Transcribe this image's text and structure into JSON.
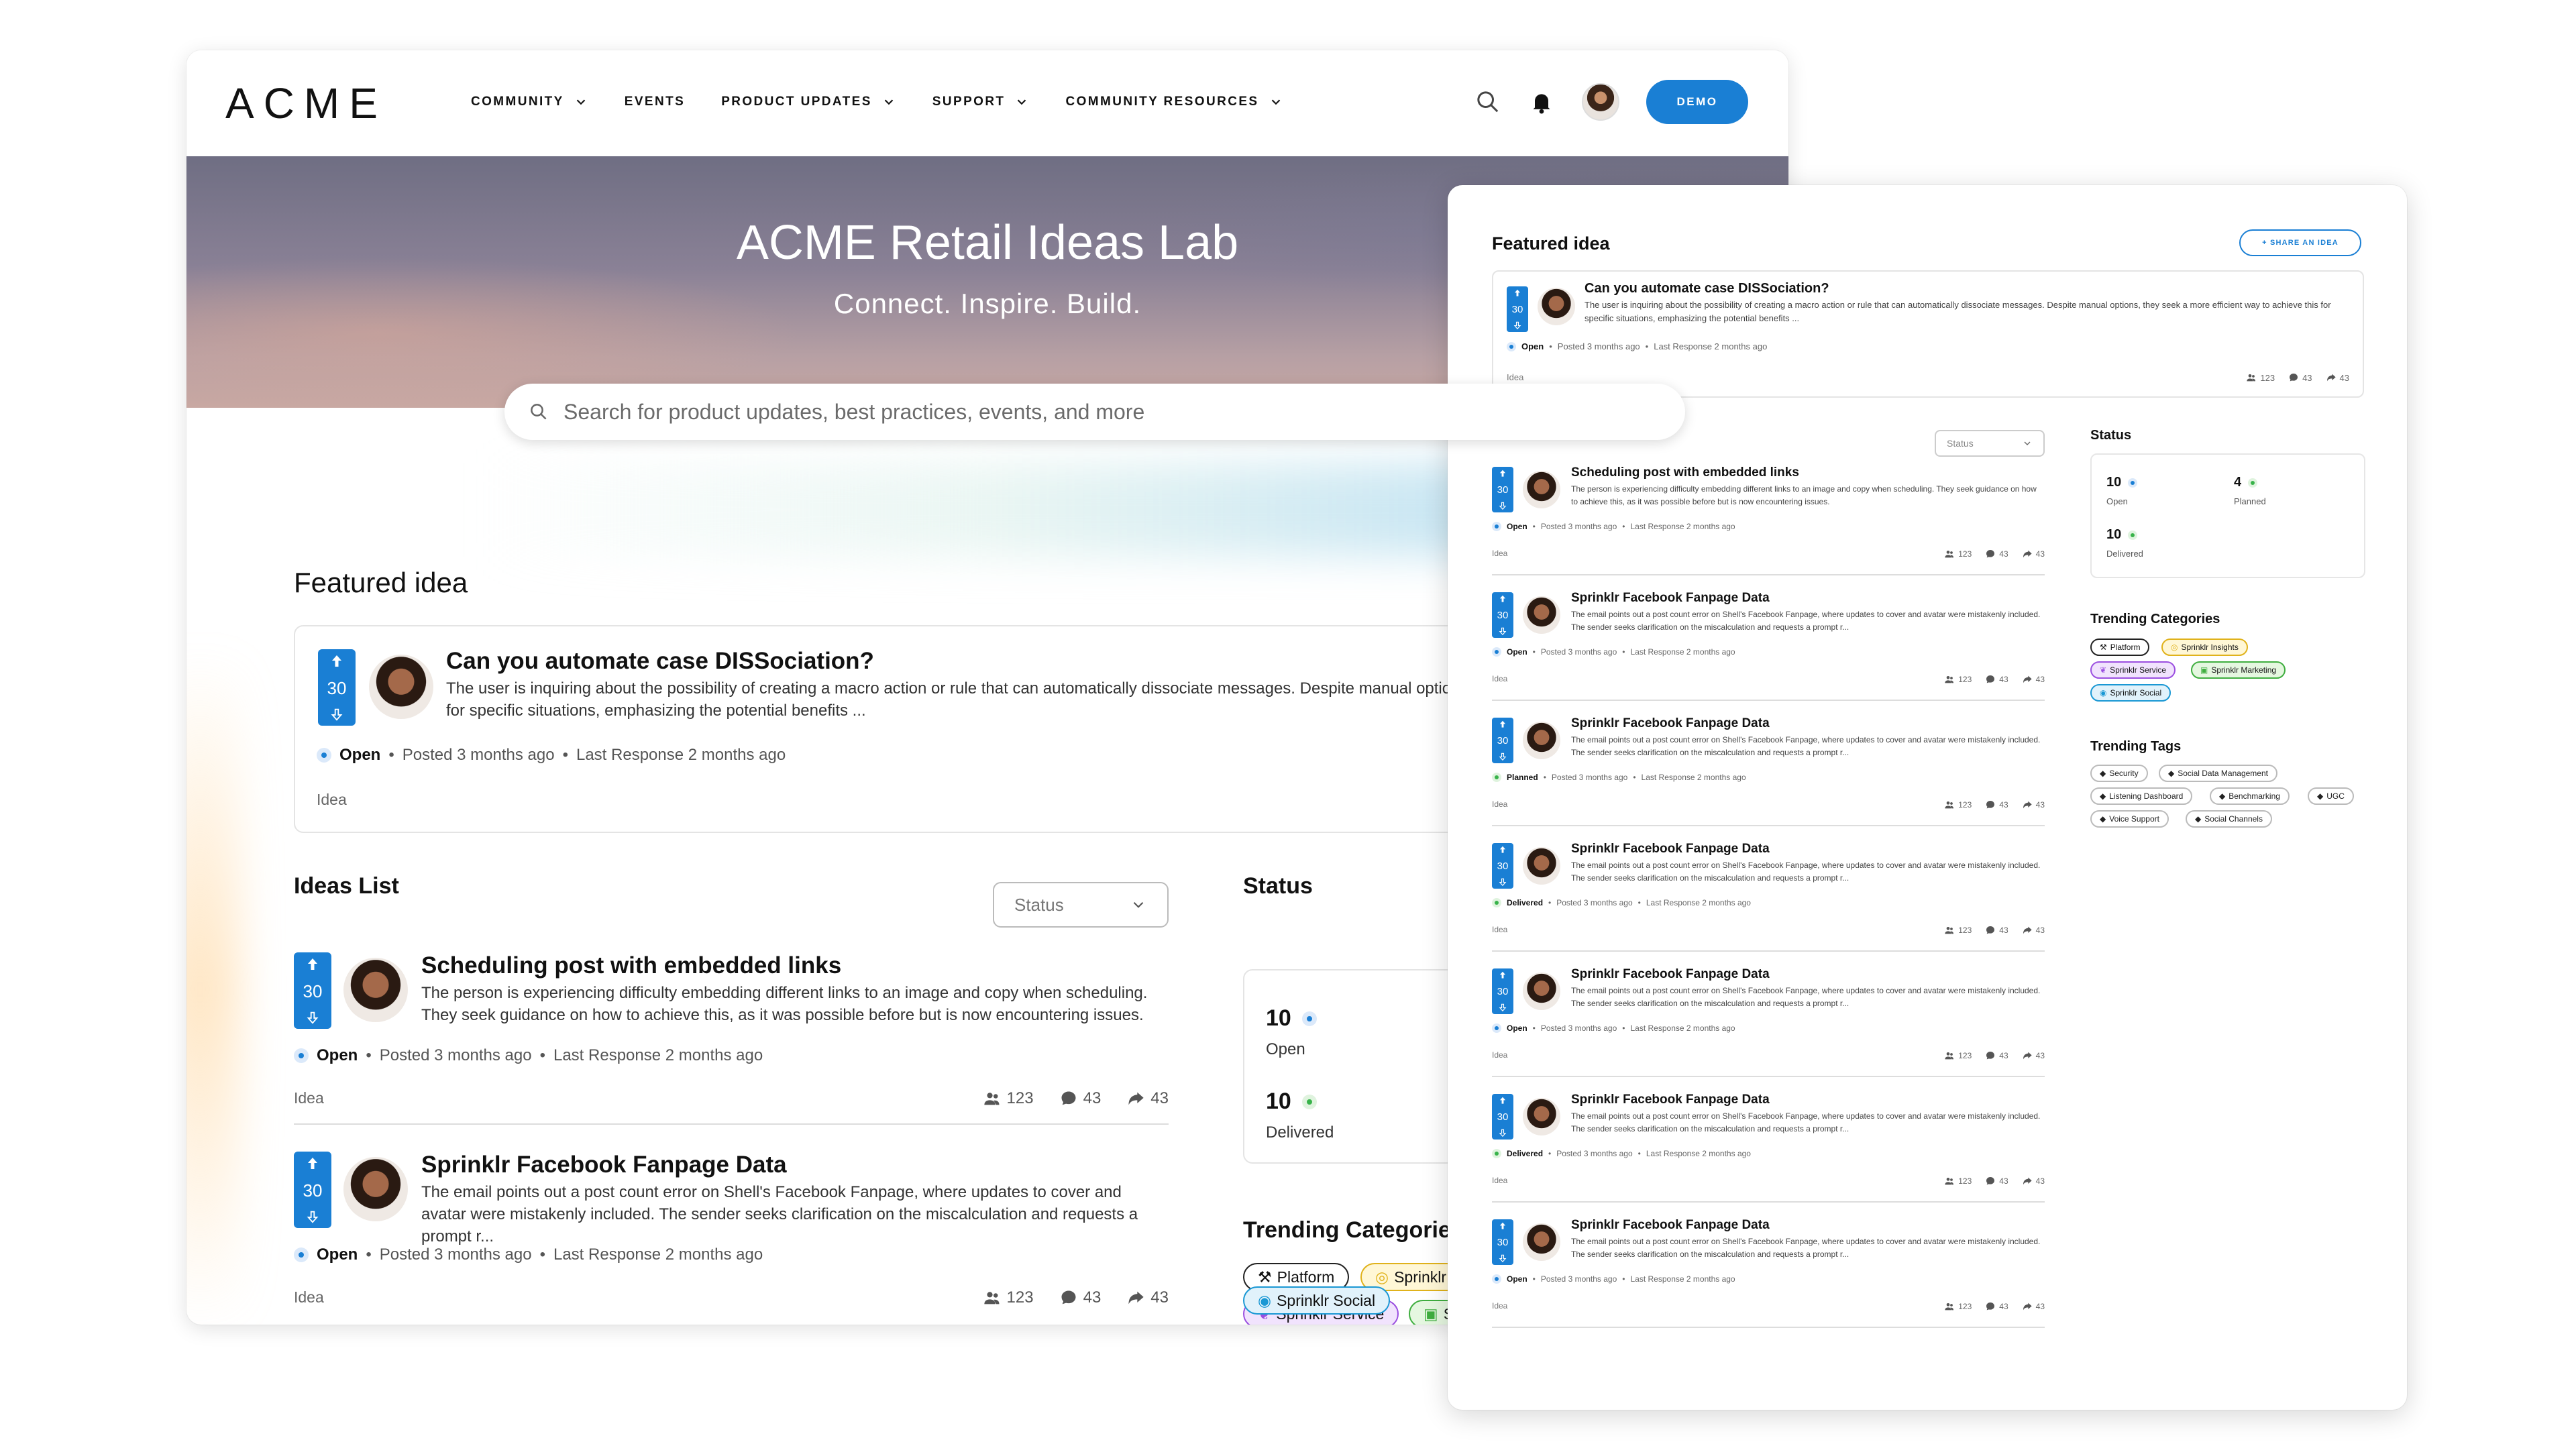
{
  "brand": {
    "logo": "ACME",
    "accent": "#1a7fd4"
  },
  "nav": {
    "items": [
      {
        "label": "COMMUNITY",
        "has_dropdown": true
      },
      {
        "label": "EVENTS",
        "has_dropdown": false
      },
      {
        "label": "PRODUCT UPDATES",
        "has_dropdown": true
      },
      {
        "label": "SUPPORT",
        "has_dropdown": true
      },
      {
        "label": "COMMUNITY RESOURCES",
        "has_dropdown": true
      }
    ],
    "demo_label": "DEMO",
    "icons": [
      "search-icon",
      "bell-icon",
      "user-avatar"
    ]
  },
  "hero": {
    "title": "ACME Retail Ideas Lab",
    "subtitle": "Connect. Inspire. Build.",
    "search_placeholder": "Search for product updates, best practices, events, and more"
  },
  "featured": {
    "heading": "Featured idea",
    "share_label": "+ SHARE AN IDEA",
    "idea": {
      "votes": "30",
      "title": "Can you automate case DISSociation?",
      "desc": "The user is inquiring about the possibility of creating a macro action or rule that can automatically dissociate messages. Despite manual options, they seek a more efficient way to achieve this for specific situations, emphasizing the potential benefits ...",
      "status": "Open",
      "posted": "Posted 3 months ago",
      "last_response": "Last Response 2 months ago",
      "tag": "Idea",
      "members": "123",
      "comments": "43",
      "shares": "43"
    }
  },
  "ideas_list": {
    "heading": "Ideas List",
    "filter_label": "Status",
    "items": [
      {
        "votes": "30",
        "title": "Scheduling post with embedded links",
        "desc": "The person is experiencing difficulty embedding different links to an image and copy when scheduling. They seek guidance on how to achieve this, as it was possible before but is now encountering issues.",
        "status": "Open",
        "status_color": "blue",
        "posted": "Posted 3 months ago",
        "last_response": "Last Response 2 months ago",
        "tag": "Idea",
        "members": "123",
        "comments": "43",
        "shares": "43"
      },
      {
        "votes": "30",
        "title": "Sprinklr Facebook Fanpage Data",
        "desc": "The email points out a post count error on Shell's Facebook Fanpage, where updates to cover and avatar were mistakenly included. The sender seeks clarification on the miscalculation and requests a prompt r...",
        "status": "Open",
        "status_color": "blue",
        "posted": "Posted 3 months ago",
        "last_response": "Last Response 2 months ago",
        "tag": "Idea",
        "members": "123",
        "comments": "43",
        "shares": "43"
      },
      {
        "votes": "30",
        "title": "Sprinklr Facebook Fanpage Data",
        "desc": "The email points out a post count error on Shell's Facebook Fanpage, where updates to cover and avatar were mistakenly included. The sender seeks clarification on the miscalculation and requests a prompt r...",
        "status": "Planned",
        "status_color": "green",
        "posted": "Posted 3 months ago",
        "last_response": "Last Response 2 months ago",
        "tag": "Idea",
        "members": "123",
        "comments": "43",
        "shares": "43"
      },
      {
        "votes": "30",
        "title": "Sprinklr Facebook Fanpage Data",
        "desc": "The email points out a post count error on Shell's Facebook Fanpage, where updates to cover and avatar were mistakenly included. The sender seeks clarification on the miscalculation and requests a prompt r...",
        "status": "Delivered",
        "status_color": "green",
        "posted": "Posted 3 months ago",
        "last_response": "Last Response 2 months ago",
        "tag": "Idea",
        "members": "123",
        "comments": "43",
        "shares": "43"
      },
      {
        "votes": "30",
        "title": "Sprinklr Facebook Fanpage Data",
        "desc": "The email points out a post count error on Shell's Facebook Fanpage, where updates to cover and avatar were mistakenly included. The sender seeks clarification on the miscalculation and requests a prompt r...",
        "status": "Open",
        "status_color": "blue",
        "posted": "Posted 3 months ago",
        "last_response": "Last Response 2 months ago",
        "tag": "Idea",
        "members": "123",
        "comments": "43",
        "shares": "43"
      },
      {
        "votes": "30",
        "title": "Sprinklr Facebook Fanpage Data",
        "desc": "The email points out a post count error on Shell's Facebook Fanpage, where updates to cover and avatar were mistakenly included. The sender seeks clarification on the miscalculation and requests a prompt r...",
        "status": "Delivered",
        "status_color": "green",
        "posted": "Posted 3 months ago",
        "last_response": "Last Response 2 months ago",
        "tag": "Idea",
        "members": "123",
        "comments": "43",
        "shares": "43"
      },
      {
        "votes": "30",
        "title": "Sprinklr Facebook Fanpage Data",
        "desc": "The email points out a post count error on Shell's Facebook Fanpage, where updates to cover and avatar were mistakenly included. The sender seeks clarification on the miscalculation and requests a prompt r...",
        "status": "Open",
        "status_color": "blue",
        "posted": "Posted 3 months ago",
        "last_response": "Last Response 2 months ago",
        "tag": "Idea",
        "members": "123",
        "comments": "43",
        "shares": "43"
      }
    ]
  },
  "status_panel": {
    "heading": "Status",
    "open": {
      "count": "10",
      "label": "Open",
      "color": "#1a7fd4"
    },
    "planned": {
      "count": "4",
      "label": "Planned",
      "color": "#38b34a"
    },
    "delivered": {
      "count": "10",
      "label": "Delivered",
      "color": "#38b34a"
    }
  },
  "trending_categories": {
    "heading": "Trending Categories",
    "back_heading": "Trending Categorie",
    "items": [
      {
        "label": "Platform",
        "icon": "platform-icon",
        "color": "#222222",
        "bg": "#ffffff"
      },
      {
        "label": "Sprinklr Insights",
        "icon": "insights-icon",
        "color": "#e0b21b",
        "bg": "#fff7d6"
      },
      {
        "label": "Sprinklr Service",
        "icon": "service-icon",
        "color": "#9b4fe0",
        "bg": "#f1e3fd"
      },
      {
        "label": "Sprinklr Marketing",
        "icon": "marketing-icon",
        "color": "#3fae3f",
        "bg": "#e5f7e0"
      },
      {
        "label": "Sprinklr Social",
        "icon": "social-icon",
        "color": "#1a98d4",
        "bg": "#e1f2fb"
      }
    ],
    "back_truncated": {
      "insights": "Sprinklr",
      "marketing": "S"
    }
  },
  "trending_tags": {
    "heading": "Trending Tags",
    "items": [
      "Security",
      "Social Data Management",
      "Listening Dashboard",
      "Benchmarking",
      "UGC",
      "Voice Support",
      "Social Channels"
    ]
  }
}
